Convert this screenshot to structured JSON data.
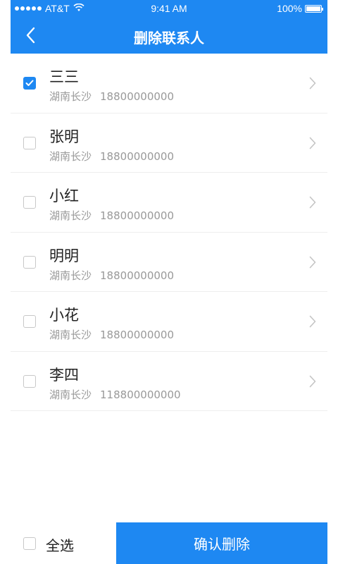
{
  "status_bar": {
    "carrier": "AT&T",
    "time": "9:41 AM",
    "battery": "100%"
  },
  "nav": {
    "title": "删除联系人",
    "back_icon": "chevron-left-icon"
  },
  "contacts": [
    {
      "name": "三三",
      "city": "湖南长沙",
      "phone": "18800000000",
      "checked": true
    },
    {
      "name": "张明",
      "city": "湖南长沙",
      "phone": "18800000000",
      "checked": false
    },
    {
      "name": "小红",
      "city": "湖南长沙",
      "phone": "18800000000",
      "checked": false
    },
    {
      "name": "明明",
      "city": "湖南长沙",
      "phone": "18800000000",
      "checked": false
    },
    {
      "name": "小花",
      "city": "湖南长沙",
      "phone": "18800000000",
      "checked": false
    },
    {
      "name": "李四",
      "city": "湖南长沙",
      "phone": "118800000000",
      "checked": false
    }
  ],
  "bottom_bar": {
    "select_all_label": "全选",
    "select_all_checked": false,
    "confirm_label": "确认删除"
  },
  "colors": {
    "accent": "#1e88f2",
    "divider": "#eeeeee",
    "secondary_text": "#999999"
  }
}
